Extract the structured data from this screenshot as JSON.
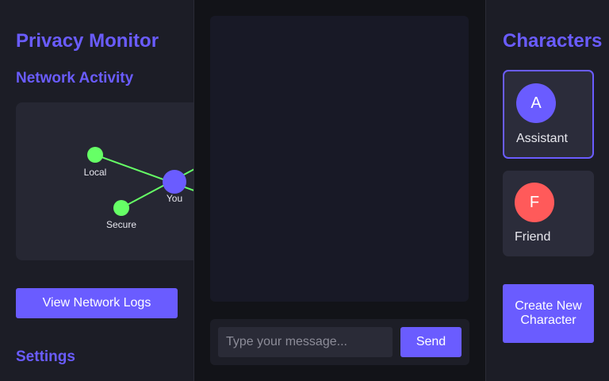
{
  "left_panel": {
    "title": "Privacy Monitor",
    "network_heading": "Network Activity",
    "network_graph": {
      "nodes": [
        {
          "id": "local",
          "label": "Local",
          "color": "#66ff66"
        },
        {
          "id": "secure",
          "label": "Secure",
          "color": "#66ff66"
        },
        {
          "id": "you",
          "label": "You",
          "color": "#6a5cff"
        }
      ]
    },
    "view_logs_label": "View Network Logs",
    "settings_heading": "Settings"
  },
  "chat": {
    "input_placeholder": "Type your message...",
    "input_value": "",
    "send_label": "Send"
  },
  "right_panel": {
    "title": "Characters",
    "characters": [
      {
        "initial": "A",
        "name": "Assistant",
        "avatar_color": "#6a5cff",
        "selected": true
      },
      {
        "initial": "F",
        "name": "Friend",
        "avatar_color": "#ff5a5a",
        "selected": false
      }
    ],
    "create_label": "Create New Character"
  },
  "colors": {
    "accent": "#6a5cff",
    "node_green": "#66ff66",
    "friend_red": "#ff5a5a"
  }
}
